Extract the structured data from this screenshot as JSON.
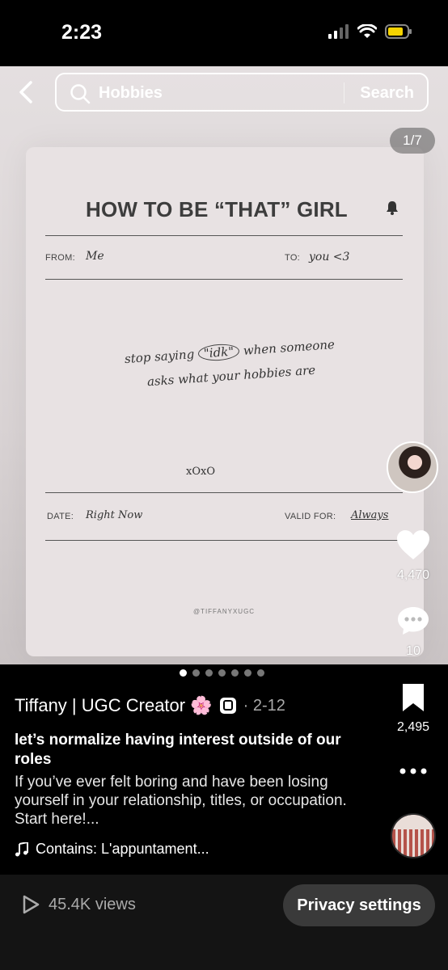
{
  "status_bar": {
    "time": "2:23"
  },
  "search": {
    "query": "Hobbies",
    "button": "Search"
  },
  "post": {
    "counter": "1/7",
    "card": {
      "title": "HOW TO BE “THAT” GIRL",
      "from_label": "FROM:",
      "from_value": "Me",
      "to_label": "TO:",
      "to_value": "you <3",
      "message_pre": "stop saying ",
      "message_circled": "\"idk\"",
      "message_post": " when someone asks what your hobbies are",
      "signoff": "xOxO",
      "date_label": "DATE:",
      "date_value": "Right Now",
      "valid_label": "VALID FOR:",
      "valid_value": "Always",
      "credit": "@TIFFANYXUGC"
    },
    "likes": "4,470",
    "comments": "10",
    "saves": "2,495",
    "author": "Tiffany | UGC Creator 🌸",
    "date": "· 2-12",
    "title": "let’s normalize having interest outside of our roles",
    "body": "If you’ve ever felt boring and have been losing yourself in your relationship, titles, or occupation. Start here!...",
    "music": "Contains: L'appuntament..."
  },
  "footer": {
    "views": "45.4K views",
    "privacy": "Privacy settings"
  },
  "colors": {
    "accent": "#ffffff",
    "battery": "#f5d300"
  }
}
